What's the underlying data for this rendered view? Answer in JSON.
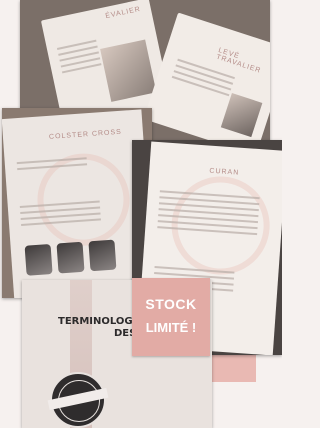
{
  "sticker": {
    "line1": "STOCK",
    "line2": "LIMITÉ !"
  },
  "photos": {
    "top_spread": {
      "left_heading": "ÉVALIER",
      "right_heading": "LEVÉ TRAVALIER"
    },
    "left_page": {
      "heading": "COLSTER CROSS"
    },
    "right_page": {
      "heading": "CURAN"
    },
    "cover": {
      "title_line1": "TERMINOLOGIE",
      "title_line2": "DES PAS"
    }
  },
  "colors": {
    "pink_accent": "#e9b9b3",
    "sticker_bg": "#e2aba5",
    "sticker_text": "#ffffff"
  }
}
